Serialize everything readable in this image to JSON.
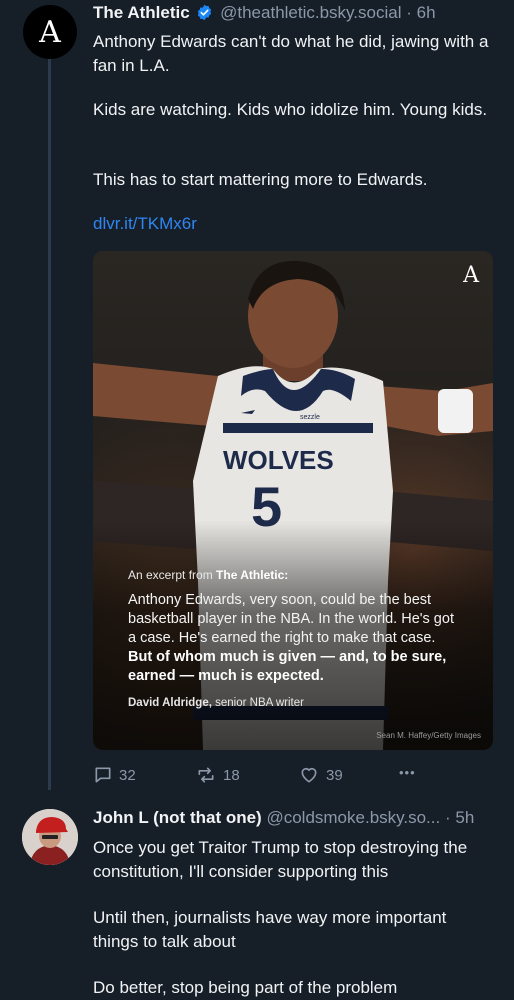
{
  "post": {
    "avatar_letter": "A",
    "author": "The Athletic",
    "handle": "@theathletic.bsky.social",
    "separator": "·",
    "time": "6h",
    "paragraphs": [
      "Anthony Edwards can't do what he did, jawing with a fan in L.A.",
      "Kids are watching. Kids who idolize him. Young kids.",
      "This has to start mattering more to Edwards."
    ],
    "link": "dlvr.it/TKMx6r",
    "embed": {
      "corner_logo": "A",
      "excerpt_prefix": "An excerpt from ",
      "excerpt_source": "The Athletic:",
      "quote_plain": "Anthony Edwards, very soon, could be the best basketball player in the NBA. In the world. He's got a case. He's earned the right to make that case. ",
      "quote_bold": "But of whom much is given — and, to be sure, earned — much is expected.",
      "byline_name": "David Aldridge,",
      "byline_role": " senior NBA writer",
      "jersey_team": "WOLVES",
      "jersey_number": "5",
      "jersey_sponsor": "sezzle",
      "photo_credit": "Sean M. Haffey/Getty Images"
    },
    "actions": {
      "replies": "32",
      "reposts": "18",
      "likes": "39",
      "more": "•••"
    }
  },
  "reply": {
    "author": "John L (not that one)",
    "handle": "@coldsmoke.bsky.so...",
    "separator": "·",
    "time": "5h",
    "paragraphs": [
      "Once you get Traitor Trump to stop destroying the constitution, I'll consider supporting this",
      "Until then, journalists have way more important things to talk about",
      "Do better, stop being part of the problem"
    ]
  },
  "colors": {
    "background": "#161e27",
    "link": "#2f86f2",
    "muted": "#8b98a9",
    "verified": "#1b86f5"
  }
}
